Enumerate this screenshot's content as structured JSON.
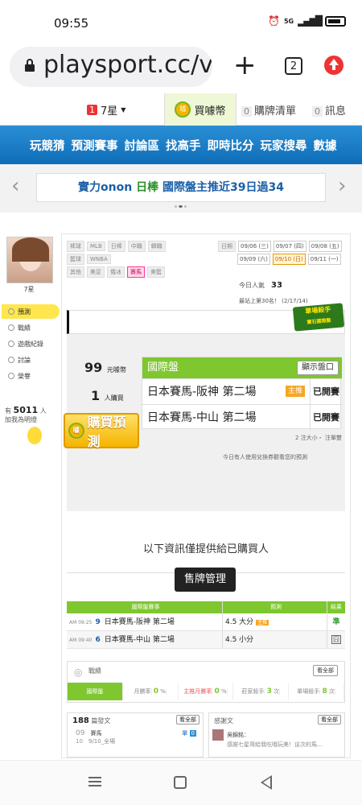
{
  "status": {
    "time": "09:55",
    "signal": "5G"
  },
  "browser": {
    "url": "playsport.cc/v",
    "tab_count": "2"
  },
  "sitebar": {
    "level_badge": "1",
    "level": "7星",
    "coin_label": "買噱幣",
    "coin_icon": "噱",
    "cart_count": "0",
    "cart": "購牌清單",
    "msg_count": "0",
    "msg": "訊息"
  },
  "nav": [
    "玩競猜",
    "預測賽事",
    "討論區",
    "找高手",
    "即時比分",
    "玩家搜尋",
    "數據"
  ],
  "promo": {
    "a": "實力onon",
    "b": "日棒",
    "c": "國際盤主推近39日過34"
  },
  "user": {
    "name": "7星",
    "menu": [
      "預測",
      "戰績",
      "遊戲紀錄",
      "討論",
      "榮譽"
    ],
    "count_pre": "有",
    "count": "5011",
    "count_suf": "人",
    "count_line2": "加我為明燈"
  },
  "filters": {
    "l1": "棒球",
    "l1_tags": [
      "MLB",
      "日棒",
      "中職",
      "韓職"
    ],
    "l2": "籃球",
    "l2_tags": [
      "WNBA"
    ],
    "l3": "其他",
    "l3_tags": [
      "美足",
      "俄冰",
      "賽馬",
      "美籃"
    ],
    "date_label": "日期",
    "dates": [
      "09/06 (三)",
      "09/07 (四)",
      "09/08 (五)",
      "09/09 (六)",
      "09/10 (日)",
      "09/11 (一)"
    ]
  },
  "stats": {
    "pop_label": "今日人氣",
    "pop": "33",
    "rank": "最站上第30名！",
    "rank_sub": "(2/17/14)"
  },
  "ribbon": {
    "l1": "單場殺手",
    "l2": "寶石國際盤"
  },
  "purchase": {
    "price": "99",
    "price_unit": "元噱幣",
    "buyers": "1",
    "buyers_unit": "人購買",
    "buy_btn": "購買預測",
    "coin": "噱"
  },
  "pred": {
    "header": "國際盤",
    "show_btn": "顯示盤口",
    "rows": [
      {
        "game": "日本賽馬-阪神 第二場",
        "tag": "主推",
        "status": "已開賽"
      },
      {
        "game": "日本賽馬-中山 第二場",
        "tag": "",
        "status": "已開賽"
      }
    ],
    "note": "2 注大小・ 注單雙",
    "note2": "今日有人使用兌換券觀看您的預測"
  },
  "info": "以下資訊僅提供給已購買人",
  "manage_btn": "售牌管理",
  "table": {
    "headers": [
      "國際盤賽事",
      "預測",
      "結果"
    ],
    "rows": [
      {
        "time": "AM 09:25",
        "num": "9",
        "game": "日本賽馬-阪神 第二場",
        "pick": "4.5 大分",
        "tag": "主推",
        "result": "準"
      },
      {
        "time": "AM 09:40",
        "num": "6",
        "game": "日本賽馬-中山 第二場",
        "pick": "4.5 小分",
        "tag": "",
        "result": "囧"
      }
    ]
  },
  "record": {
    "title": "戰績",
    "more": "看全部",
    "tabs": [
      {
        "label": "國際盤",
        "val": ""
      },
      {
        "label": "月勝率",
        "val": "0",
        "unit": "%"
      },
      {
        "label": "主推月勝率",
        "val": "0",
        "unit": "%"
      },
      {
        "label": "莊家殺手",
        "val": "3",
        "unit": "次"
      },
      {
        "label": "單場殺手",
        "val": "8",
        "unit": "次"
      }
    ]
  },
  "posts": {
    "count": "188",
    "label": "篇發文",
    "more": "看全部",
    "date_top": "09",
    "date_bottom": "10",
    "title": "賽馬",
    "sub": "9/10_全場",
    "tag": "單",
    "badge": "0"
  },
  "thanks": {
    "label": "感謝文",
    "more": "看全部",
    "user": "吳錦銘：",
    "text": "感謝七星哥給我吃哦玩美！這次的馬..."
  }
}
